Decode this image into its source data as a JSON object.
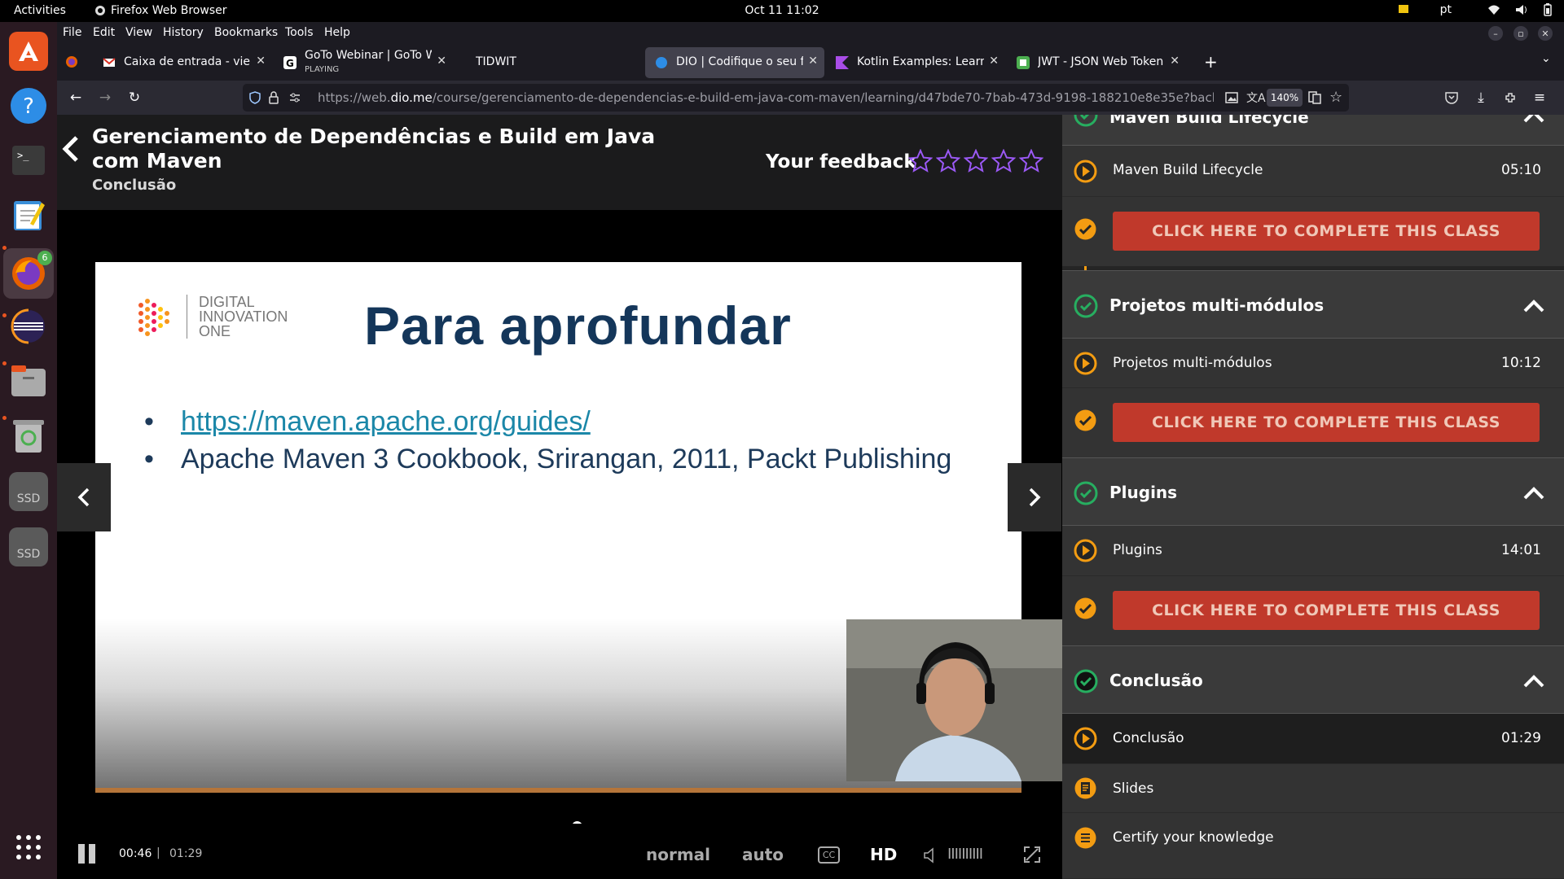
{
  "system": {
    "activities": "Activities",
    "app_name": "Firefox Web Browser",
    "datetime": "Oct 11  11:02",
    "lang": "pt"
  },
  "dock": {
    "firefox_badge": "6",
    "ssd_label": "SSD"
  },
  "browser": {
    "menu": [
      "File",
      "Edit",
      "View",
      "History",
      "Bookmarks",
      "Tools",
      "Help"
    ],
    "tabs": [
      {
        "title": "Caixa de entrada - vieira.f",
        "sub": ""
      },
      {
        "title": "GoTo Webinar | GoTo Wel",
        "sub": "PLAYING"
      },
      {
        "title": "TIDWIT",
        "sub": ""
      },
      {
        "title": "DIO | Codifique o seu futu",
        "sub": ""
      },
      {
        "title": "Kotlin Examples: Learn Ko",
        "sub": ""
      },
      {
        "title": "JWT - JSON Web Token -",
        "sub": ""
      }
    ],
    "url_prefix": "https://web.",
    "url_domain": "dio.me",
    "url_rest": "/course/gerenciamento-de-dependencias-e-build-em-java-com-maven/learning/d47bde70-7bab-473d-9198-188210e8e35e?back=/track/co",
    "zoom": "140%"
  },
  "course": {
    "title": "Gerenciamento de Dependências e Build em Java com Maven",
    "subtitle": "Conclusão",
    "feedback_label": "Your feedback",
    "rating": 0,
    "rating_max": 5
  },
  "slide": {
    "logo_text": [
      "DIGITAL",
      "INNOVATION",
      "ONE"
    ],
    "heading": "Para aprofundar",
    "bullets": [
      "https://maven.apache.org/guides/",
      "Apache Maven 3 Cookbook, Srirangan, 2011, Packt Publishing"
    ]
  },
  "player": {
    "current": "00:46",
    "separator": "|",
    "duration": "01:29",
    "progress": 0.517,
    "buffered": 0.786,
    "speed": "normal",
    "quality": "auto",
    "cc": "CC",
    "hd": "HD",
    "volume": "IIIIIIIIII"
  },
  "sidebar": {
    "complete_label": "CLICK HERE TO COMPLETE THIS CLASS",
    "sections": [
      {
        "name": "Maven Build Lifecycle",
        "lesson": "Maven Build Lifecycle",
        "duration": "05:10"
      },
      {
        "name": "Projetos multi-módulos",
        "lesson": "Projetos multi-módulos",
        "duration": "10:12"
      },
      {
        "name": "Plugins",
        "lesson": "Plugins",
        "duration": "14:01"
      },
      {
        "name": "Conclusão",
        "lesson": "Conclusão",
        "duration": "01:29"
      }
    ],
    "extras": [
      "Slides",
      "Certify your knowledge"
    ]
  },
  "colors": {
    "accent": "#f39c12",
    "complete_button": "#c0392b",
    "check_green": "#27ae60",
    "star_purple": "#9b59f6"
  }
}
